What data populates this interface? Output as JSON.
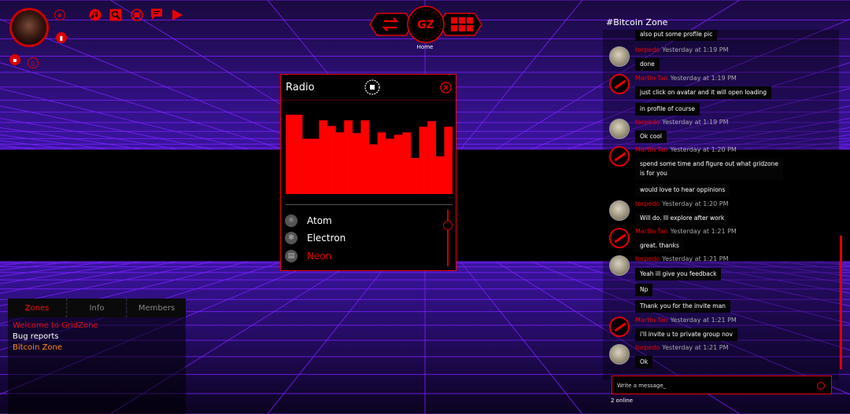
{
  "header": {
    "avatar_badge_text": "",
    "home_label": "Home",
    "logo_text": "GZ"
  },
  "radio": {
    "title": "Radio",
    "levels": [
      0.99,
      0.99,
      0.69,
      0.69,
      0.92,
      0.85,
      0.77,
      0.92,
      0.76,
      0.92,
      0.62,
      0.77,
      0.69,
      0.74,
      0.77,
      0.45,
      0.84,
      0.91,
      0.47,
      0.84
    ],
    "bar_color": "#ff0000",
    "stations": [
      {
        "label": "Atom",
        "icon": "atom-icon",
        "active": false
      },
      {
        "label": "Electron",
        "icon": "electron-icon",
        "active": false
      },
      {
        "label": "Neon",
        "icon": "neon-icon",
        "active": true
      }
    ]
  },
  "zones_panel": {
    "tabs": [
      {
        "label": "Zones",
        "active": true
      },
      {
        "label": "Info",
        "active": false
      },
      {
        "label": "Members",
        "active": false
      }
    ],
    "items": [
      {
        "label": "Welcome to GridZone",
        "color": "#e01010"
      },
      {
        "label": "Bug reports",
        "color": "#ffffff"
      },
      {
        "label": "Bitcoin Zone",
        "color": "#ff8a1a"
      }
    ]
  },
  "chat": {
    "title": "#Bitcoin Zone",
    "messages": [
      {
        "text": "also put some profile pic"
      },
      {
        "user": "torpedo",
        "time": "Yesterday at 1:19 PM",
        "text": "done"
      },
      {
        "user": "Martin Tan",
        "time": "Yesterday at 1:19 PM",
        "text": "just click on avatar and it will open loading"
      },
      {
        "text": "in profile of course"
      },
      {
        "user": "torpedo",
        "time": "Yesterday at 1:19 PM",
        "text": "Ok cool"
      },
      {
        "user": "Martin Tan",
        "time": "Yesterday at 1:20 PM",
        "text": "spend some time and figure out what gridzone",
        "text2": "is for you"
      },
      {
        "text": "would love to hear oppinions"
      },
      {
        "user": "torpedo",
        "time": "Yesterday at 1:20 PM",
        "text": "Will do. Ill explore after work"
      },
      {
        "user": "Martin Tan",
        "time": "Yesterday at 1:21 PM",
        "text": "great. thanks"
      },
      {
        "user": "torpedo",
        "time": "Yesterday at 1:21 PM",
        "text": "Yeah ill give you feedback"
      },
      {
        "text": "Np"
      },
      {
        "text": "Thank you for the invite man"
      },
      {
        "user": "Martin Tan",
        "time": "Yesterday at 1:21 PM",
        "text": "i'll invite u to private group nov"
      },
      {
        "user": "torpedo",
        "time": "Yesterday at 1:21 PM",
        "text": "Ok"
      }
    ],
    "input_placeholder": "Write a message_",
    "online_text": "2 online"
  },
  "colors": {
    "accent": "#e00000",
    "grid": "#7a22ff",
    "background": "#000000"
  }
}
